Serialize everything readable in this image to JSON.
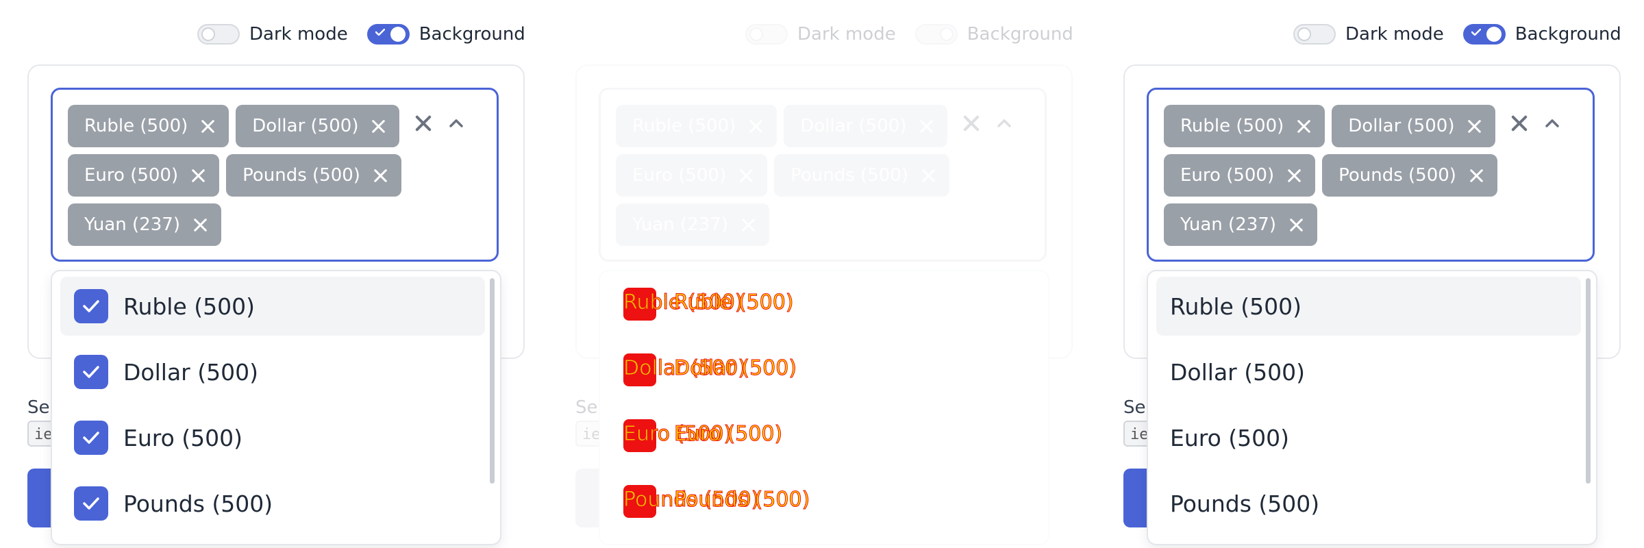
{
  "toolbar": {
    "dark_mode_label": "Dark mode",
    "background_label": "Background"
  },
  "panels": [
    {
      "tags": [
        "Ruble (500)",
        "Dollar (500)",
        "Euro (500)",
        "Pounds (500)",
        "Yuan (237)"
      ],
      "options": [
        "Ruble (500)",
        "Dollar (500)",
        "Euro (500)",
        "Pounds (500)"
      ],
      "behind_label": "Se",
      "behind_input": "ie"
    },
    {
      "tags": [
        "Ruble (500)",
        "Dollar (500)",
        "Euro (500)",
        "Pounds (500)",
        "Yuan (237)"
      ],
      "options": [
        "Ruble (500)",
        "Dollar (500)",
        "Euro (500)",
        "Pounds (500)"
      ],
      "behind_label": "Se",
      "behind_input": "ie"
    },
    {
      "tags": [
        "Ruble (500)",
        "Dollar (500)",
        "Euro (500)",
        "Pounds (500)",
        "Yuan (237)"
      ],
      "options": [
        "Ruble (500)",
        "Dollar (500)",
        "Euro (500)",
        "Pounds (500)"
      ],
      "behind_label": "Se",
      "behind_input": "ie"
    }
  ],
  "colors": {
    "accent": "#4a64d6",
    "tag_bg": "#9aa0a8",
    "highlight_bg": "#f3f4f6"
  }
}
